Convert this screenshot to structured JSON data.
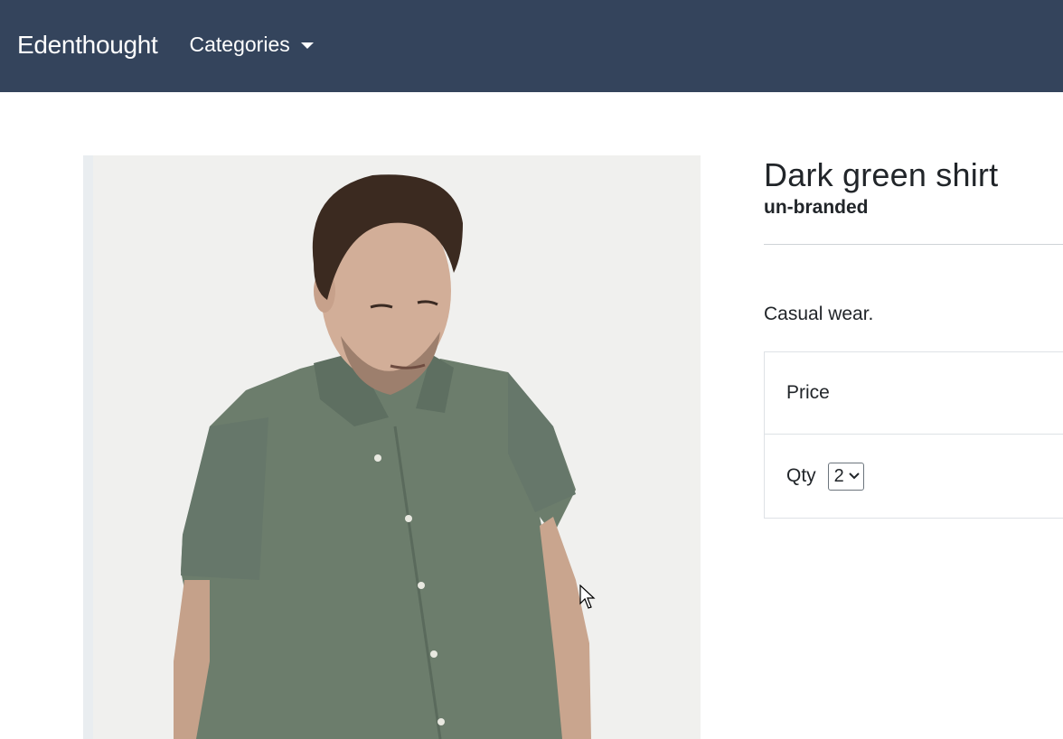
{
  "navbar": {
    "brand": "Edenthought",
    "categories_label": "Categories",
    "background": "#34445c"
  },
  "product": {
    "image_alt": "Man wearing dark green short-sleeve linen shirt",
    "title": "Dark green shirt",
    "brand": "un-branded",
    "description": "Casual wear.",
    "price_label": "Price",
    "qty_label": "Qty",
    "qty_value": "2"
  },
  "icons": {
    "caret": "caret-down-icon",
    "select_chevron": "chevron-down-icon",
    "cursor": "mouse-pointer-icon"
  }
}
